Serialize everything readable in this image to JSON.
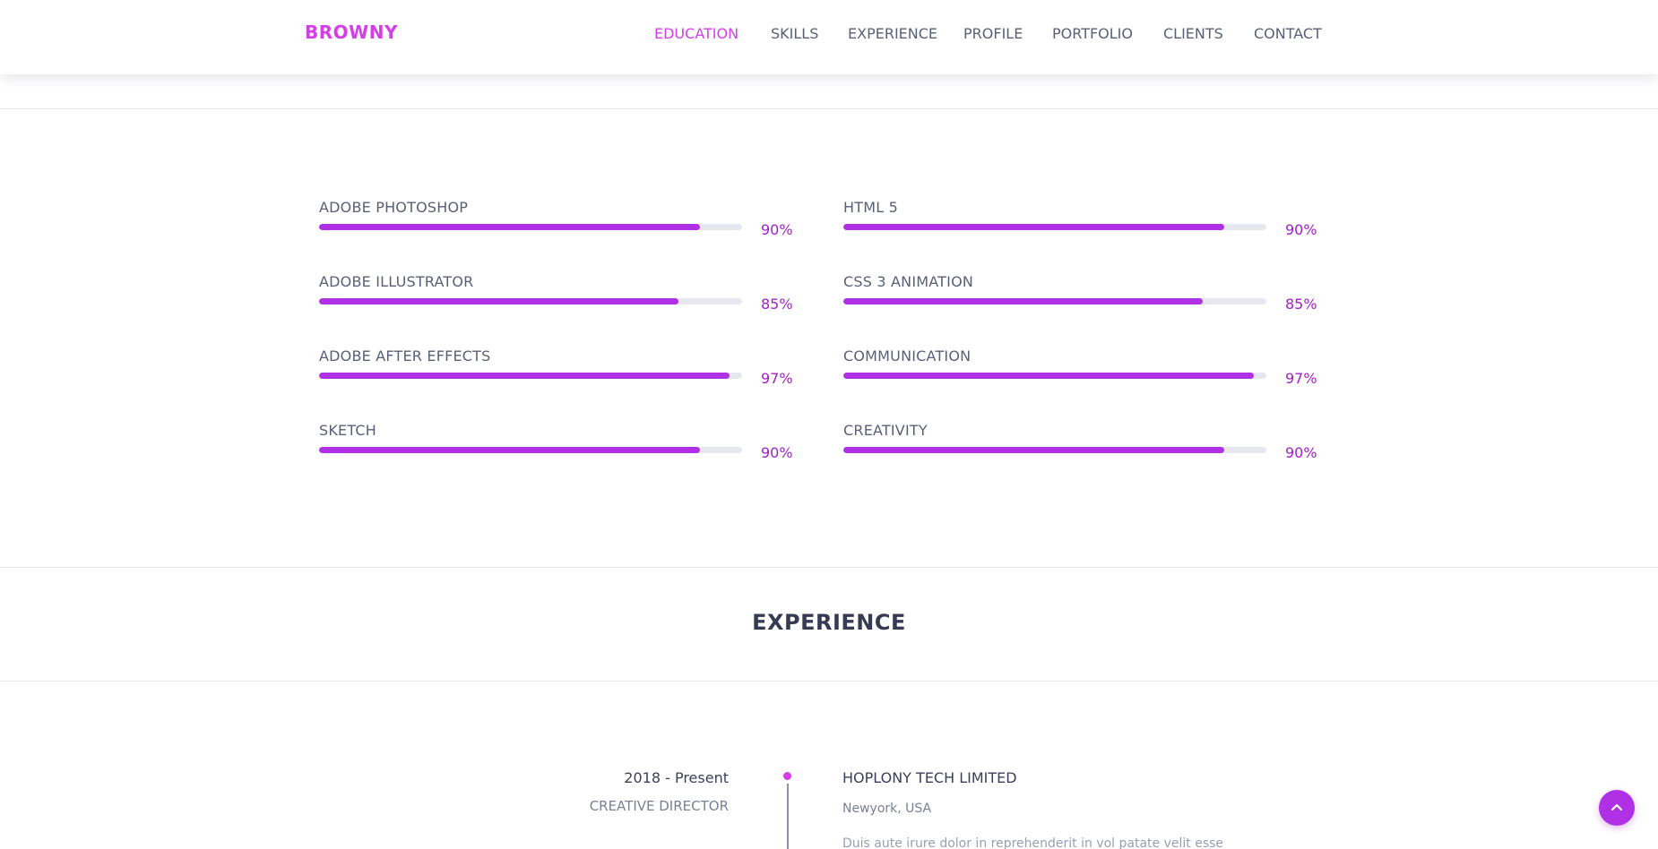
{
  "header": {
    "logo": "BROWNY",
    "nav": [
      {
        "label": "EDUCATION",
        "active": true
      },
      {
        "label": "SKILLS",
        "active": false
      },
      {
        "label": "EXPERIENCE",
        "active": false
      },
      {
        "label": "PROFILE",
        "active": false
      },
      {
        "label": "PORTFOLIO",
        "active": false
      },
      {
        "label": "CLIENTS",
        "active": false
      },
      {
        "label": "CONTACT",
        "active": false
      }
    ]
  },
  "skills": {
    "left": [
      {
        "name": "ADOBE PHOTOSHOP",
        "percent_label": "90%",
        "value": 90
      },
      {
        "name": "ADOBE ILLUSTRATOR",
        "percent_label": "85%",
        "value": 85
      },
      {
        "name": "ADOBE AFTER EFFECTS",
        "percent_label": "97%",
        "value": 97
      },
      {
        "name": "SKETCH",
        "percent_label": "90%",
        "value": 90
      }
    ],
    "right": [
      {
        "name": "HTML 5",
        "percent_label": "90%",
        "value": 90
      },
      {
        "name": "CSS 3 ANIMATION",
        "percent_label": "85%",
        "value": 85
      },
      {
        "name": "COMMUNICATION",
        "percent_label": "97%",
        "value": 97
      },
      {
        "name": "CREATIVITY",
        "percent_label": "90%",
        "value": 90
      }
    ]
  },
  "experience": {
    "title": "EXPERIENCE",
    "items": [
      {
        "period": "2018 - Present",
        "role": "CREATIVE DIRECTOR",
        "company": "HOPLONY TECH LIMITED",
        "location": "Newyork, USA",
        "description": "Duis aute irure dolor in reprehenderit in vol patate velit esse"
      }
    ]
  },
  "colors": {
    "accent": "#d63ce8",
    "bar_fill": "#b031e5",
    "bar_track": "#e7e8ef",
    "percent_text": "#a31fc8"
  },
  "icons": {
    "back_to_top": "chevron-up-icon"
  }
}
